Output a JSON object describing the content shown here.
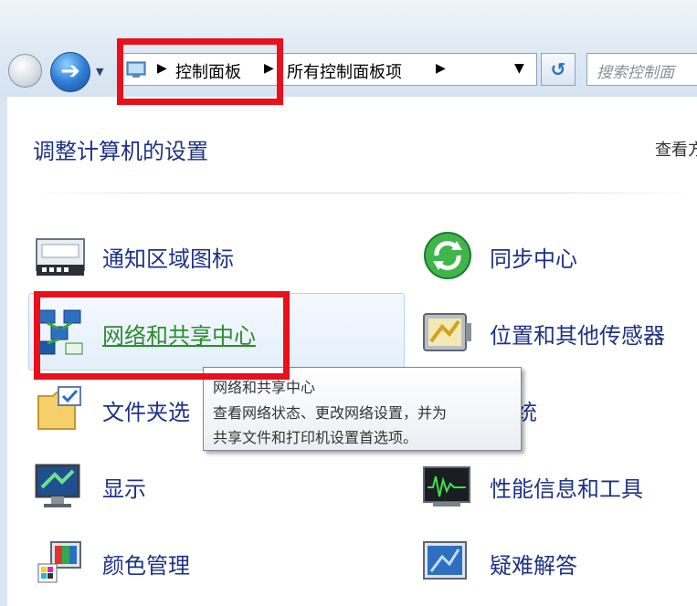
{
  "address_bar": {
    "crumbs": [
      "控制面板",
      "所有控制面板项"
    ],
    "search_placeholder": "搜索控制面"
  },
  "page": {
    "title": "调整计算机的设置",
    "view_by": "查看方"
  },
  "items": {
    "notification_icons": "通知区域图标",
    "sync_center": "同步中心",
    "network_sharing": "网络和共享中心",
    "location_sensors": "位置和其他传感器",
    "folder_options": "文件夹选",
    "system_partial": "统",
    "display": "显示",
    "performance": "性能信息和工具",
    "color_management": "颜色管理",
    "troubleshooting": "疑难解答"
  },
  "tooltip": {
    "title": "网络和共享中心",
    "line1": "查看网络状态、更改网络设置，并为",
    "line2": "共享文件和打印机设置首选项。"
  },
  "colors": {
    "highlight_box": "#e8101a",
    "link": "#1e3287",
    "hover_link": "#2e8b2e"
  }
}
